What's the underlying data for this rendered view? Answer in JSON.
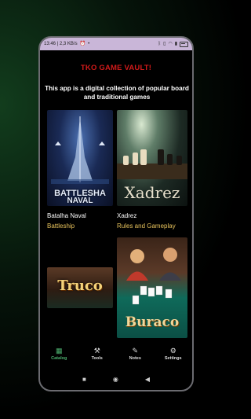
{
  "status_bar": {
    "left": "13:46 | 2,3 KB/s",
    "battery": ""
  },
  "app": {
    "title": "TKO GAME VAULT!",
    "description": "This app is a digital collection of popular board and traditional games"
  },
  "games": [
    {
      "cover_text_1": "BATTLESHA",
      "cover_text_2": "NAVAL",
      "name": "Batalha Naval",
      "subtitle": "Battleship"
    },
    {
      "cover_text_1": "Xadrez",
      "name": "Xadrez",
      "subtitle": "Rules and Gameplay"
    },
    {
      "cover_text_1": "Truco"
    },
    {
      "cover_text_1": "Buraco"
    }
  ],
  "nav": [
    {
      "label": "Catalog",
      "icon": "grid-icon",
      "active": true
    },
    {
      "label": "Tools",
      "icon": "tools-icon"
    },
    {
      "label": "Notes",
      "icon": "notes-icon"
    },
    {
      "label": "Settings",
      "icon": "gear-icon"
    }
  ],
  "colors": {
    "title_red": "#d21a1a",
    "subtitle_gold": "#e7c25c",
    "accent_green": "#4caf6e",
    "status_bar": "#c9b6d8"
  }
}
